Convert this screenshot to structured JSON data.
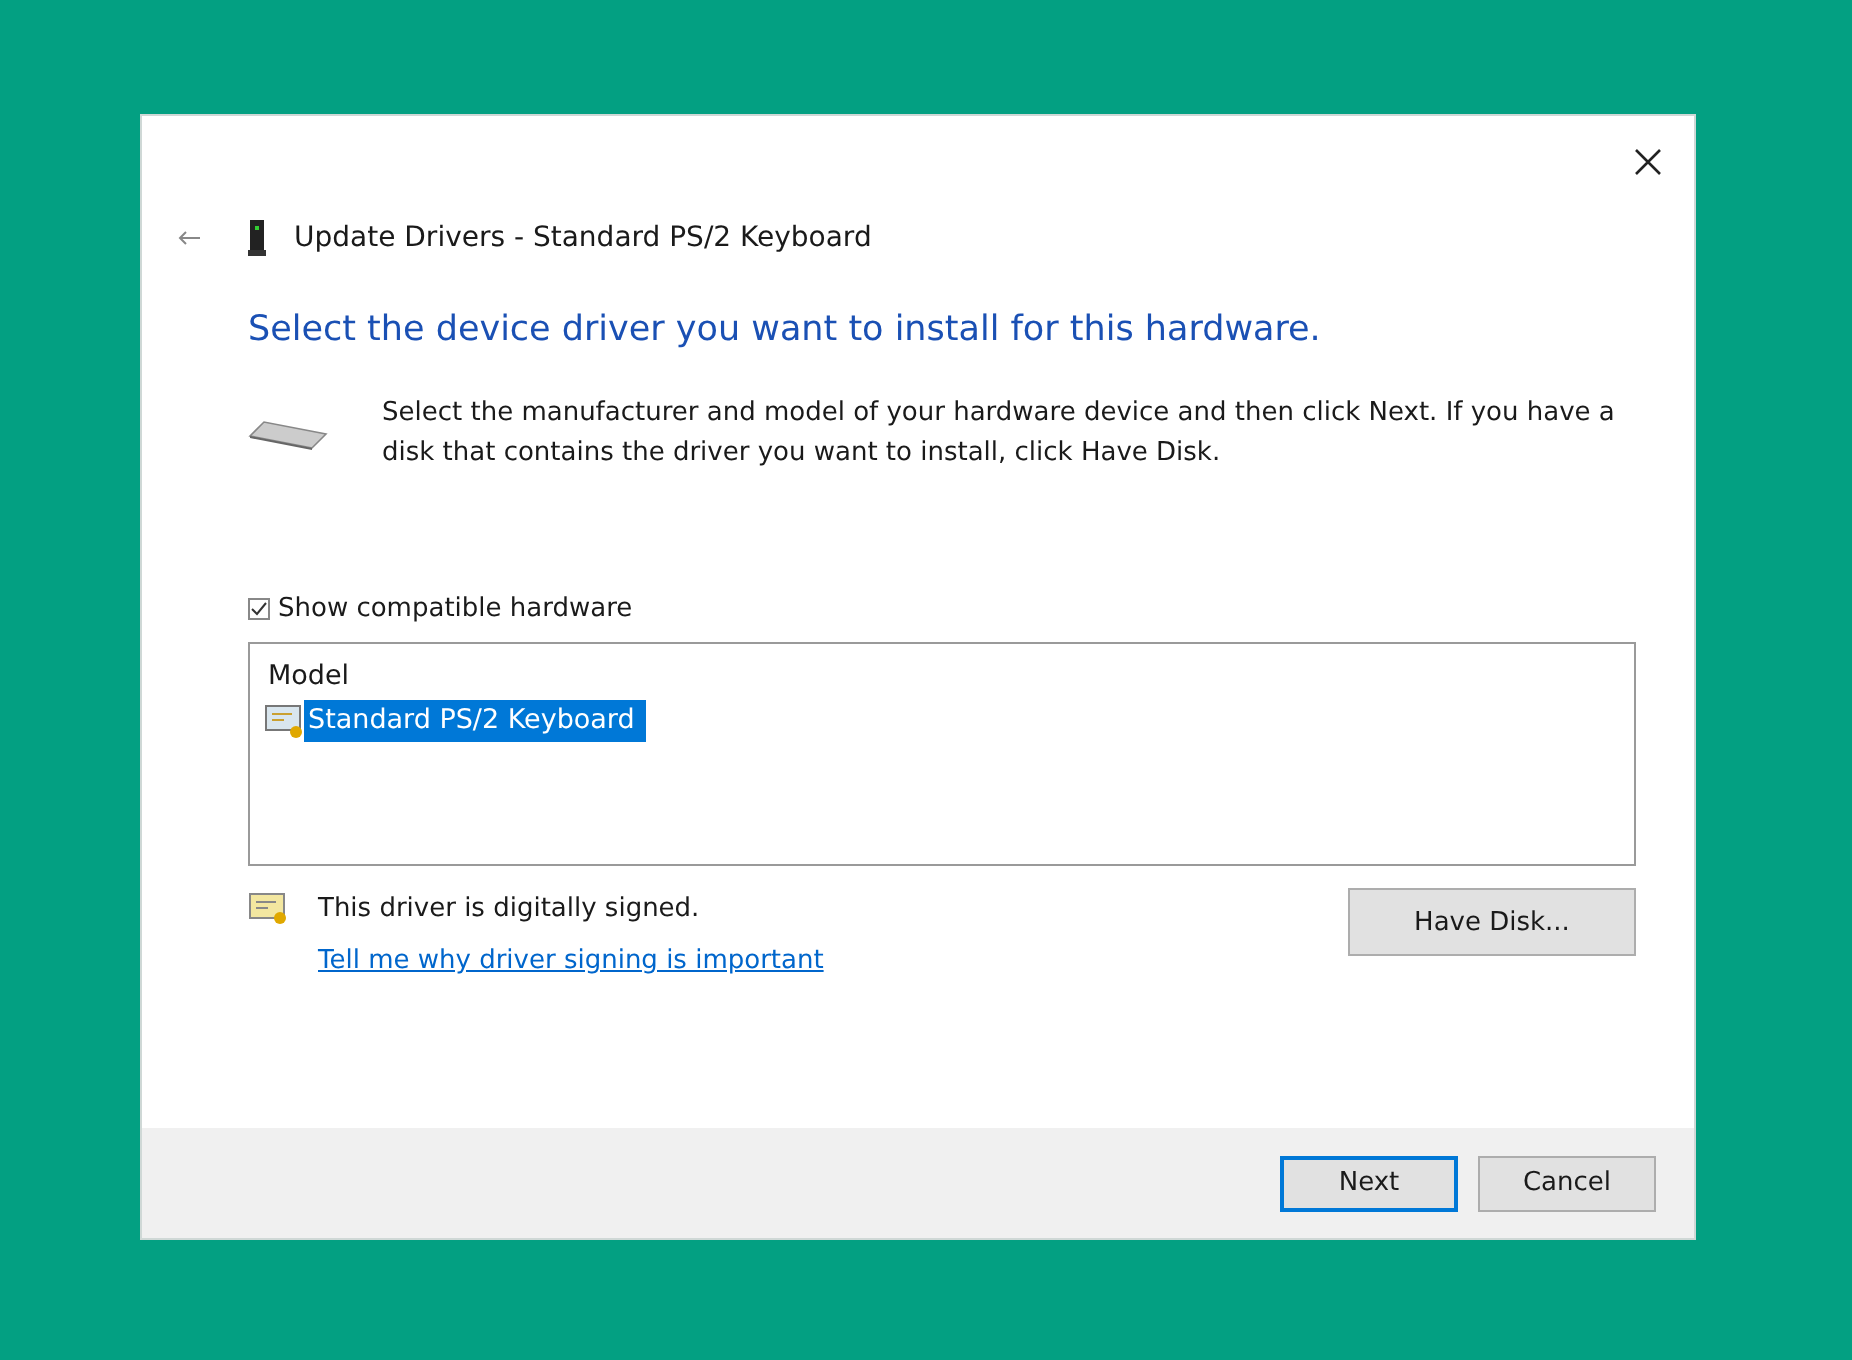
{
  "window": {
    "title": "Update Drivers - Standard PS/2 Keyboard"
  },
  "heading": "Select the device driver you want to install for this hardware.",
  "instructions": "Select the manufacturer and model of your hardware device and then click Next. If you have a disk that contains the driver you want to install, click Have Disk.",
  "show_compatible": {
    "label": "Show compatible hardware",
    "checked": true
  },
  "model_list": {
    "column": "Model",
    "items": [
      {
        "label": "Standard PS/2 Keyboard",
        "selected": true
      }
    ]
  },
  "signature": {
    "text": "This driver is digitally signed.",
    "link": "Tell me why driver signing is important"
  },
  "have_disk_button": "Have Disk...",
  "buttons": [
    {
      "label": "Next",
      "default": true
    },
    {
      "label": "Cancel",
      "default": false
    }
  ]
}
